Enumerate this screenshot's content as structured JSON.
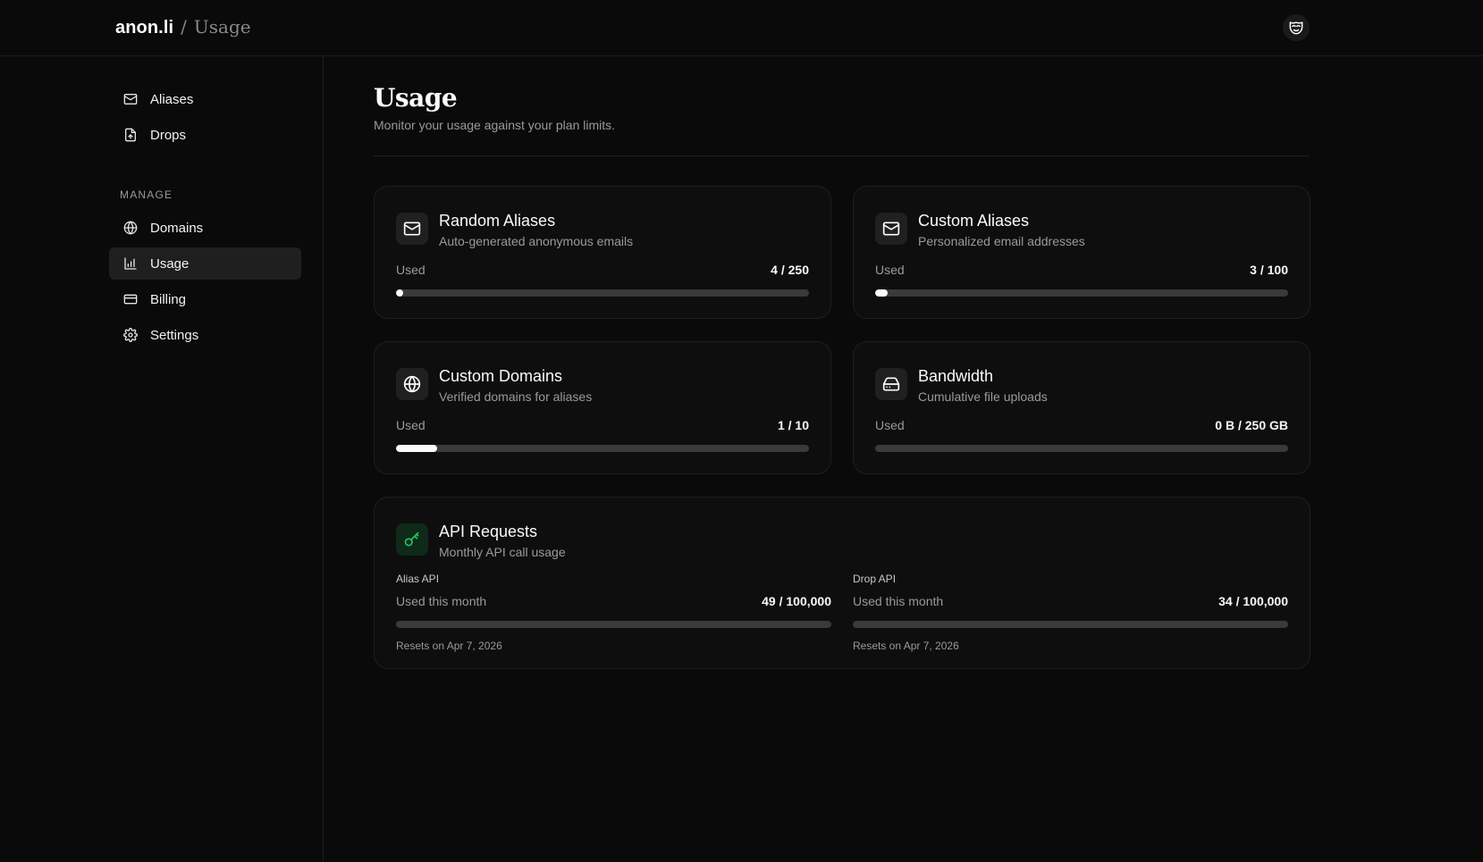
{
  "header": {
    "brand": "anon.li",
    "separator": "/",
    "page": "Usage",
    "avatar_icon": "mask-icon"
  },
  "sidebar": {
    "items": [
      {
        "label": "Aliases",
        "icon": "mail-icon"
      },
      {
        "label": "Drops",
        "icon": "file-upload-icon"
      }
    ],
    "section_label": "MANAGE",
    "manage_items": [
      {
        "label": "Domains",
        "icon": "globe-icon"
      },
      {
        "label": "Usage",
        "icon": "bar-chart-icon",
        "active": true
      },
      {
        "label": "Billing",
        "icon": "credit-card-icon"
      },
      {
        "label": "Settings",
        "icon": "gear-icon"
      }
    ]
  },
  "main": {
    "title": "Usage",
    "subtitle": "Monitor your usage against your plan limits.",
    "cards": [
      {
        "title": "Random Aliases",
        "desc": "Auto-generated anonymous emails",
        "used_label": "Used",
        "used_value": "4 / 250",
        "fraction": 0.016,
        "icon": "mail-icon"
      },
      {
        "title": "Custom Aliases",
        "desc": "Personalized email addresses",
        "used_label": "Used",
        "used_value": "3 / 100",
        "fraction": 0.03,
        "icon": "mail-icon"
      },
      {
        "title": "Custom Domains",
        "desc": "Verified domains for aliases",
        "used_label": "Used",
        "used_value": "1 / 10",
        "fraction": 0.1,
        "icon": "globe-icon"
      },
      {
        "title": "Bandwidth",
        "desc": "Cumulative file uploads",
        "used_label": "Used",
        "used_value": "0 B / 250 GB",
        "fraction": 0,
        "icon": "hard-drive-icon"
      }
    ],
    "api": {
      "title": "API Requests",
      "desc": "Monthly API call usage",
      "icon": "key-icon",
      "accent": "#22c55e",
      "columns": [
        {
          "title": "Alias API",
          "used_label": "Used this month",
          "used_value": "49 / 100,000",
          "fraction": 0.00049,
          "reset": "Resets on Apr 7, 2026"
        },
        {
          "title": "Drop API",
          "used_label": "Used this month",
          "used_value": "34 / 100,000",
          "fraction": 0.00034,
          "reset": "Resets on Apr 7, 2026"
        }
      ]
    }
  }
}
